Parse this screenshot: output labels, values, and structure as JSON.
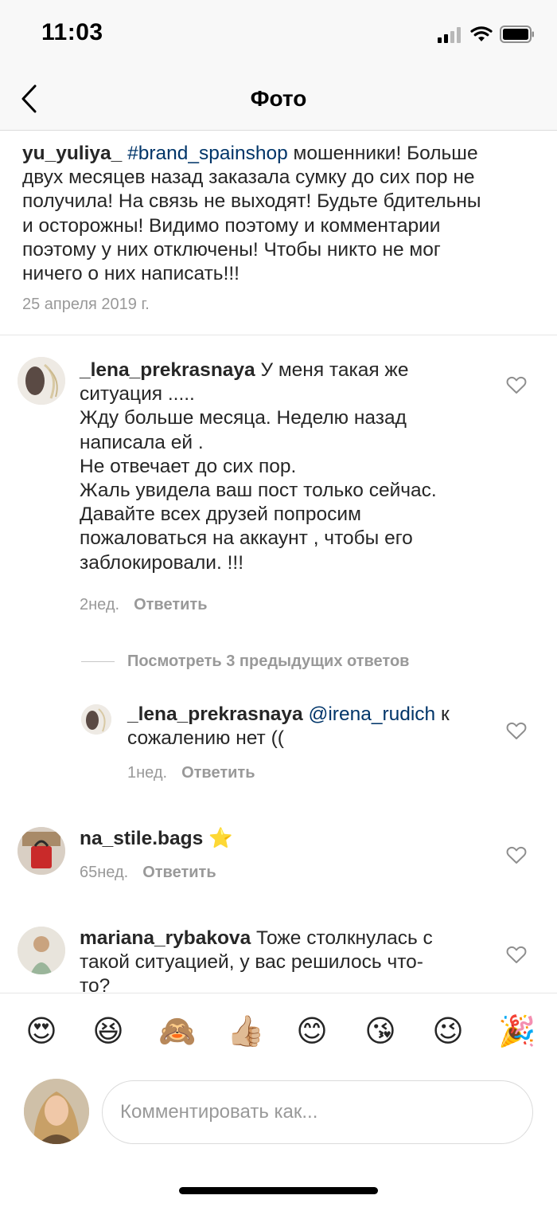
{
  "status_bar": {
    "time": "11:03"
  },
  "nav": {
    "title": "Фото"
  },
  "caption": {
    "username": "yu_yuliya_",
    "hashtag": "#brand_spainshop",
    "line1_rest": "  мошенники! Больше",
    "lines": [
      "двух месяцев назад заказала сумку до сих пор не",
      "получила! На связь не выходят! Будьте бдительны",
      "и осторожны! Видимо поэтому и комментарии",
      "поэтому у них отключены! Чтобы никто не мог",
      "ничего о них написать!!!"
    ],
    "date": "25 апреля 2019 г."
  },
  "comments": [
    {
      "username": "_lena_prekrasnaya",
      "first_line_rest": " У меня такая же",
      "lines": [
        "ситуация .....",
        "Жду больше месяца.  Неделю назад",
        "написала ей .",
        "Не отвечает до сих пор.",
        "Жаль увидела ваш пост только сейчас.",
        "Давайте всех друзей попросим",
        "пожаловаться на аккаунт , чтобы его",
        "заблокировали. !!!"
      ],
      "time": "2нед.",
      "reply_label": "Ответить"
    },
    {
      "username": "na_stile.bags",
      "emoji": "⭐",
      "time": "65нед.",
      "reply_label": "Ответить"
    },
    {
      "username": "mariana_rybakova",
      "first_line_rest": " Тоже столкнулась с",
      "lines": [
        "такой ситуацией, у вас решилось что-",
        "то?"
      ]
    }
  ],
  "view_replies": "Посмотреть 3 предыдущих ответов",
  "reply": {
    "username": "_lena_prekrasnaya",
    "mention": "@irena_rudich",
    "first_line_rest": " к",
    "lines": [
      "сожалению нет (("
    ],
    "time": "1нед.",
    "reply_label": "Ответить"
  },
  "emoji_bar": [
    "😍",
    "😆",
    "🙈",
    "👍🏼",
    "😊",
    "😘",
    "😉",
    "🎉"
  ],
  "composer": {
    "placeholder": "Комментировать как..."
  },
  "colors": {
    "accent_link": "#003569",
    "muted": "#999999",
    "text": "#262626"
  },
  "icons": [
    "back-chevron-icon",
    "heart-outline-icon",
    "signal-icon",
    "wifi-icon",
    "battery-icon"
  ]
}
